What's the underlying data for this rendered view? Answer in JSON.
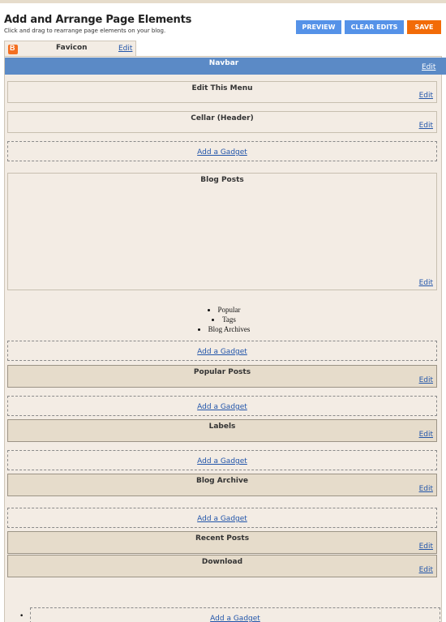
{
  "header": {
    "title": "Add and Arrange Page Elements",
    "subtitle": "Click and drag to rearrange page elements on your blog."
  },
  "toolbar": {
    "preview_label": "PREVIEW",
    "clear_label": "CLEAR EDITS",
    "save_label": "SAVE"
  },
  "favicon": {
    "label": "Favicon",
    "edit": "Edit",
    "icon": "blogger-logo-icon"
  },
  "navbar": {
    "title": "Navbar",
    "edit": "Edit"
  },
  "widgets": {
    "edit_menu": {
      "title": "Edit This Menu",
      "edit": "Edit"
    },
    "cellar_header": {
      "title": "Cellar (Header)",
      "edit": "Edit"
    },
    "blog_posts": {
      "title": "Blog Posts",
      "edit": "Edit"
    },
    "popular_posts": {
      "title": "Popular Posts",
      "edit": "Edit"
    },
    "labels": {
      "title": "Labels",
      "edit": "Edit"
    },
    "blog_archive": {
      "title": "Blog Archive",
      "edit": "Edit"
    },
    "recent_posts": {
      "title": "Recent Posts",
      "edit": "Edit"
    },
    "download": {
      "title": "Download",
      "edit": "Edit"
    }
  },
  "add_gadget_label": "Add a Gadget",
  "tab_list": [
    "Popular",
    "Tags",
    "Blog Archives"
  ],
  "colors": {
    "accent_blue": "#5592e8",
    "save_orange": "#f26b08",
    "navbar_blue": "#5b8ac6",
    "panel_bg": "#f3ece4",
    "widget_dark_bg": "#e6dccb",
    "link": "#2255aa"
  }
}
